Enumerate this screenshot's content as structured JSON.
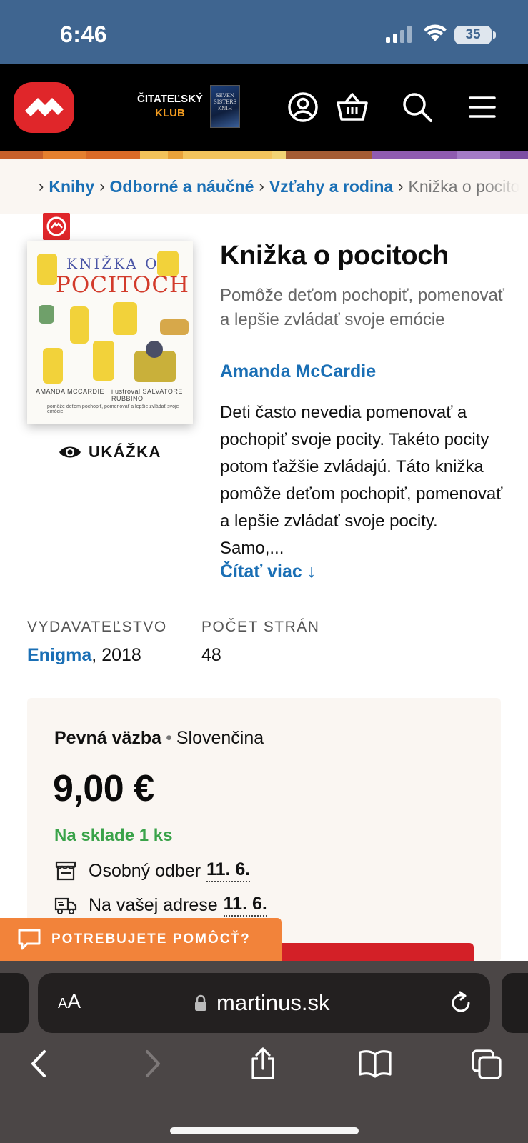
{
  "status_bar": {
    "time": "6:46",
    "battery": "35"
  },
  "header": {
    "club_line1": "ČITATEĽSKÝ",
    "club_line2": "KLUB",
    "club_book_text": "SEVEN SISTERS KNIH",
    "icons": [
      "account-icon",
      "basket-icon",
      "search-icon",
      "menu-icon"
    ]
  },
  "breadcrumb": {
    "items": [
      "Knihy",
      "Odborné a náučné",
      "Vzťahy a rodina"
    ],
    "current": "Knižka o pocitoch"
  },
  "product": {
    "cover": {
      "title_line1": "KNIŽKA O",
      "title_line2": "POCITOCH",
      "author": "AMANDA MCCARDIE",
      "illustrator": "ilustroval SALVATORE RUBBINO",
      "subtitle": "pomôže deťom pochopiť, pomenovať a lepšie zvládať svoje emócie"
    },
    "sample_label": "UKÁŽKA",
    "title": "Knižka o pocitoch",
    "subtitle": "Pomôže deťom pochopiť, pomenovať a lepšie zvládať svoje emócie",
    "author": "Amanda McCardie",
    "description": "Deti často nevedia pomenovať a pochopiť svoje pocity. Takéto pocity potom ťažšie zvládajú. Táto knižka pomôže deťom pochopiť, pomenovať a lepšie zvládať svoje pocity. Samo,...",
    "read_more": "Čítať viac ↓",
    "publisher_label": "VYDAVATEĽSTVO",
    "publisher": "Enigma",
    "year": ", 2018",
    "pages_label": "POČET STRÁN",
    "pages": "48"
  },
  "purchase": {
    "binding": "Pevná väzba",
    "separator": "•",
    "language": "Slovenčina",
    "price": "9,00 €",
    "stock": "Na sklade 1 ks",
    "pickup_label": "Osobný odber",
    "pickup_date": "11. 6.",
    "delivery_label": "Na vašej adrese",
    "delivery_date": "11. 6."
  },
  "help": {
    "label": "POTREBUJETE POMÔCŤ?"
  },
  "browser": {
    "aa_small": "A",
    "aa_large": "A",
    "url": "martinus.sk"
  },
  "colors": {
    "status_bar": "#3f6590",
    "brand_red": "#e0262a",
    "link_blue": "#1a6fb5",
    "stock_green": "#3aa34a",
    "help_orange": "#f2833a"
  }
}
